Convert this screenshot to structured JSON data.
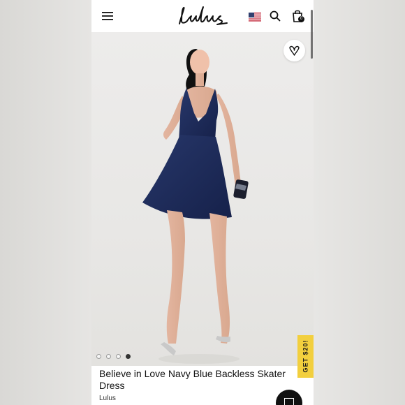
{
  "header": {
    "logo_text": "Lulus",
    "menu_icon": "hamburger-menu-icon",
    "flag_icon": "us-flag-icon",
    "search_icon": "search-icon",
    "bag_icon": "shopping-bag-icon",
    "bag_count": "0"
  },
  "gallery": {
    "favorite_icon": "heart-outline-icon",
    "dots_count": 4,
    "active_dot": 4
  },
  "promo": {
    "label": "GET $20!",
    "color": "#f2cf3e"
  },
  "product": {
    "title": "Believe in Love Navy Blue Backless Skater Dress",
    "brand": "Lulus",
    "dress_color": "#1d2a55"
  },
  "chat": {
    "icon": "chat-icon"
  }
}
